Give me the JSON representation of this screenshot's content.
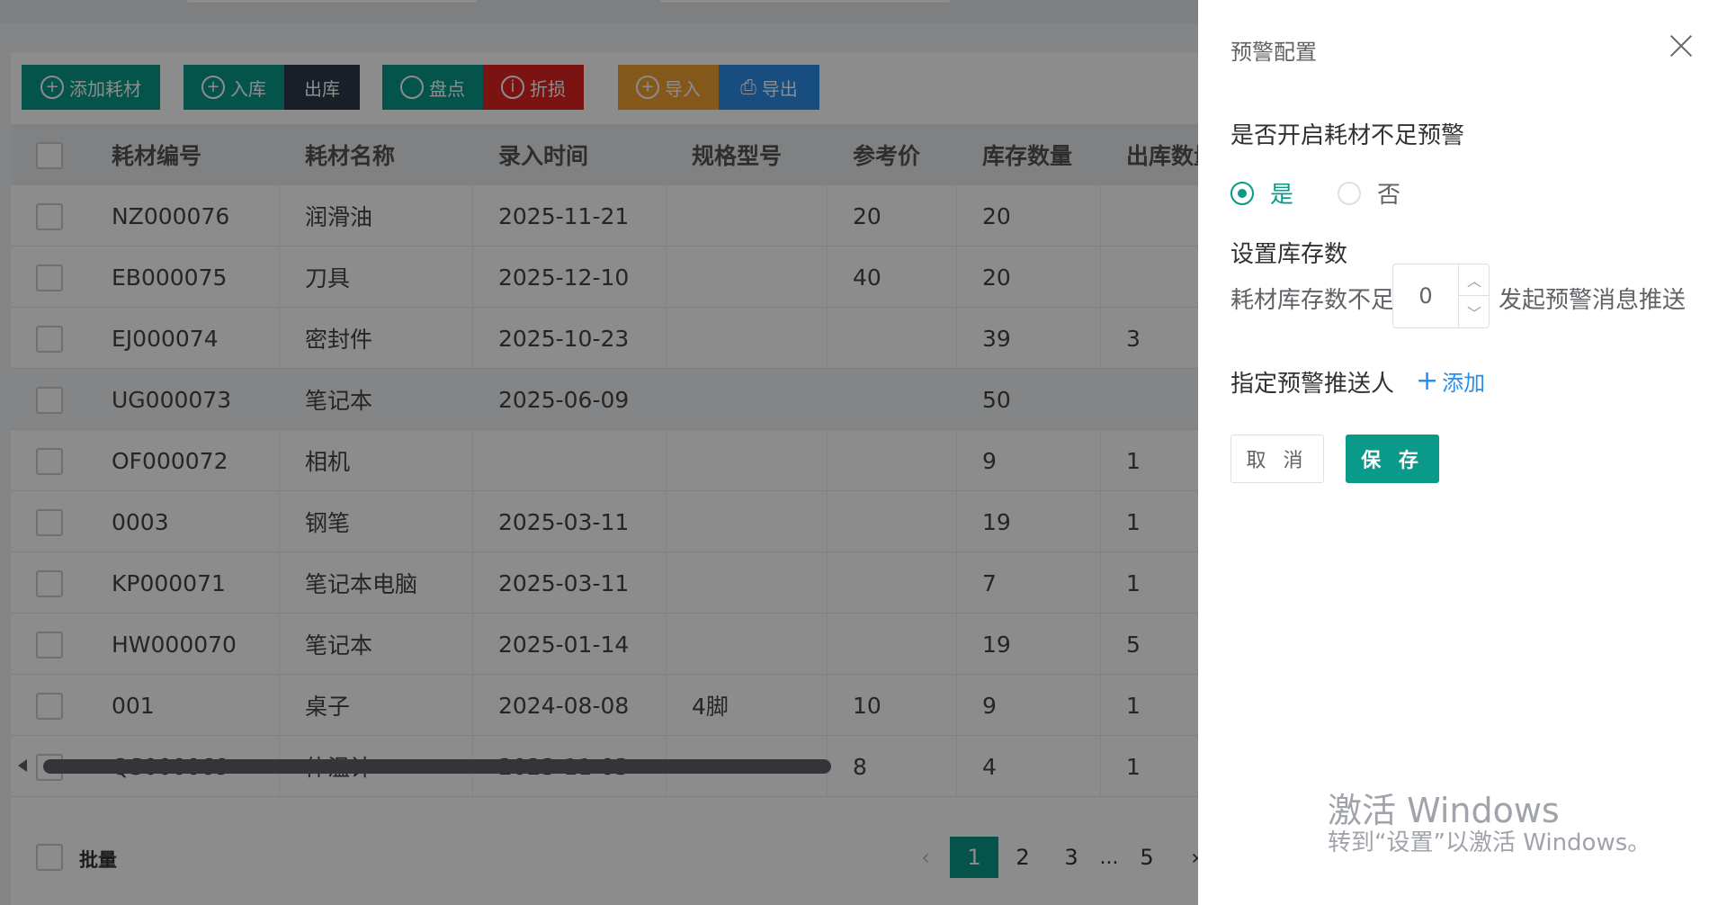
{
  "toolbar": {
    "buttons": [
      {
        "label": "添加耗材",
        "icon": "plus-circle-icon",
        "color": "#0a9a8a"
      },
      {
        "label": "入库",
        "icon": "plus-circle-icon",
        "color": "#0a9a8a"
      },
      {
        "label": "出库",
        "icon": "",
        "color": "#2f3a4a"
      },
      {
        "label": "盘点",
        "icon": "circle-icon",
        "color": "#0a9a8a"
      },
      {
        "label": "折损",
        "icon": "info-circle-icon",
        "color": "#e02424"
      },
      {
        "label": "导入",
        "icon": "plus-circle-icon",
        "color": "#f0a030"
      },
      {
        "label": "导出",
        "icon": "export-icon",
        "color": "#2a8fe8"
      }
    ]
  },
  "table": {
    "columns": [
      "耗材编号",
      "耗材名称",
      "录入时间",
      "规格型号",
      "参考价",
      "库存数量",
      "出库数量"
    ],
    "rows": [
      [
        "NZ000076",
        "润滑油",
        "2025-11-21",
        "",
        "20",
        "20",
        ""
      ],
      [
        "EB000075",
        "刀具",
        "2025-12-10",
        "",
        "40",
        "20",
        ""
      ],
      [
        "EJ000074",
        "密封件",
        "2025-10-23",
        "",
        "",
        "39",
        "3"
      ],
      [
        "UG000073",
        "笔记本",
        "2025-06-09",
        "",
        "",
        "50",
        ""
      ],
      [
        "OF000072",
        "相机",
        "",
        "",
        "",
        "9",
        "1"
      ],
      [
        "0003",
        "钢笔",
        "2025-03-11",
        "",
        "",
        "19",
        "1"
      ],
      [
        "KP000071",
        "笔记本电脑",
        "2025-03-11",
        "",
        "",
        "7",
        "1"
      ],
      [
        "HW000070",
        "笔记本",
        "2025-01-14",
        "",
        "",
        "19",
        "5"
      ],
      [
        "001",
        "桌子",
        "2024-08-08",
        "4脚",
        "10",
        "9",
        "1"
      ],
      [
        "QS000069",
        "体温计",
        "2023-11-03",
        "",
        "8",
        "4",
        "1"
      ]
    ]
  },
  "footer": {
    "batch_label": "批量",
    "pages": [
      "1",
      "2",
      "3",
      "5"
    ],
    "ellipsis": "...",
    "current_page": "1"
  },
  "drawer": {
    "title": "预警配置",
    "question_enable": "是否开启耗材不足预警",
    "option_yes": "是",
    "option_no": "否",
    "selected": "是",
    "question_stock": "设置库存数",
    "stock_prefix": "耗材库存数不足",
    "stock_value": "0",
    "stock_suffix": "发起预警消息推送",
    "question_recipient": "指定预警推送人",
    "add_label": "添加",
    "cancel_label": "取 消",
    "save_label": "保 存",
    "accent_color": "#0a9a8a"
  },
  "watermark": {
    "line1": "激活 Windows",
    "line2": "转到“设置”以激活 Windows。"
  }
}
